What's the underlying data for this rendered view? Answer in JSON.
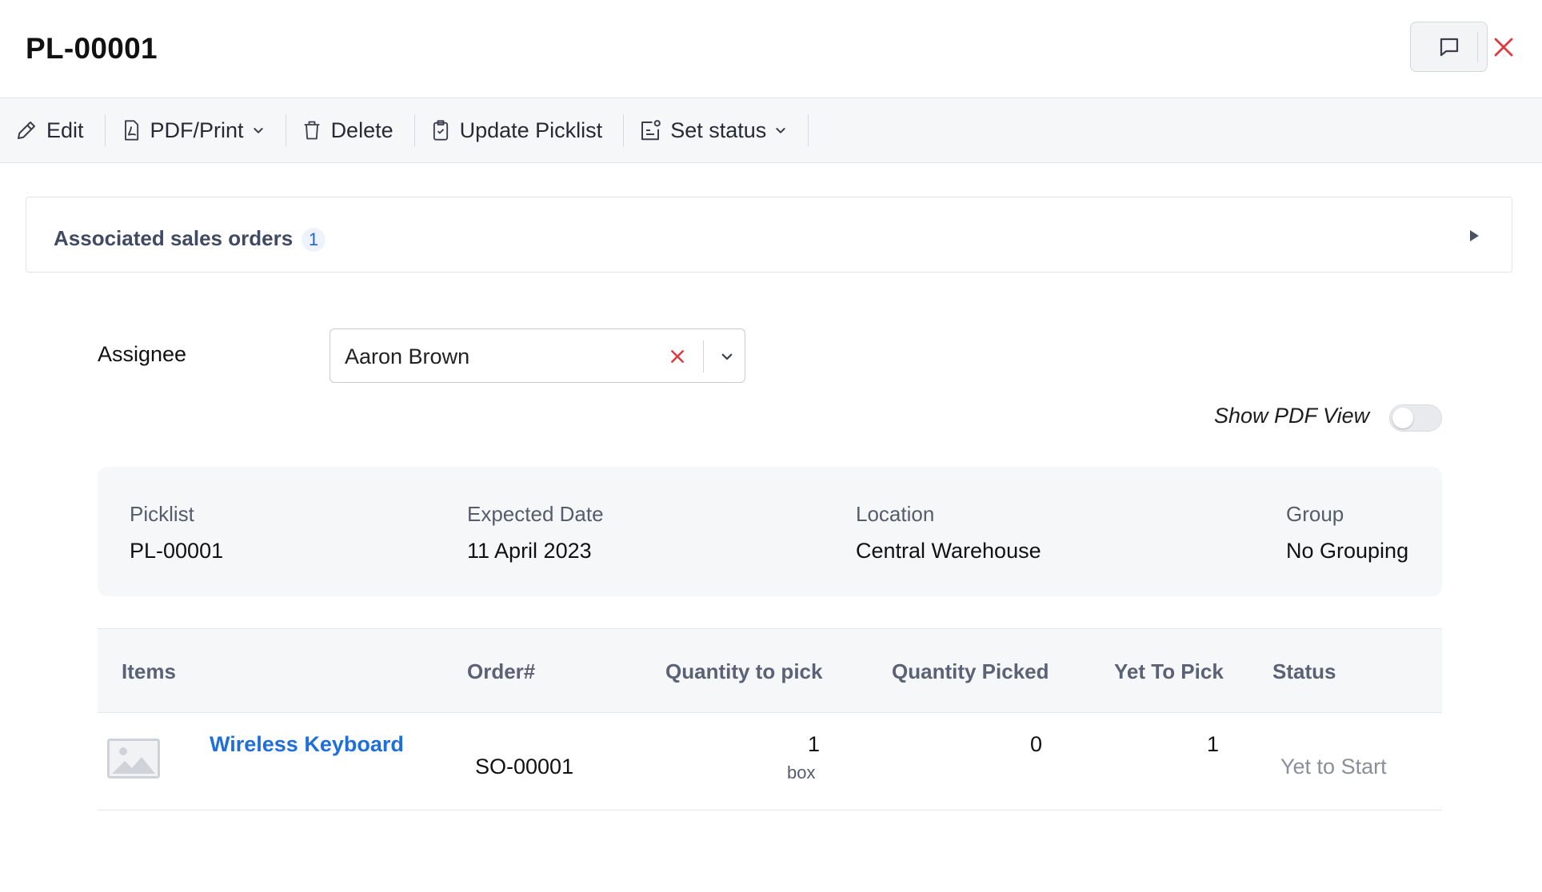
{
  "header": {
    "title": "PL-00001"
  },
  "toolbar": {
    "edit": "Edit",
    "pdf_print": "PDF/Print",
    "delete": "Delete",
    "update_picklist": "Update Picklist",
    "set_status": "Set status"
  },
  "associated": {
    "label": "Associated sales orders",
    "count": "1"
  },
  "assignee": {
    "label": "Assignee",
    "value": "Aaron Brown"
  },
  "pdf_view": {
    "label": "Show PDF View",
    "enabled": false
  },
  "summary": {
    "picklist_label": "Picklist",
    "picklist_value": "PL-00001",
    "date_label": "Expected Date",
    "date_value": "11 April 2023",
    "location_label": "Location",
    "location_value": "Central Warehouse",
    "group_label": "Group",
    "group_value": "No Grouping"
  },
  "table": {
    "columns": [
      "Items",
      "Order#",
      "Quantity to pick",
      "Quantity Picked",
      "Yet To Pick",
      "Status"
    ],
    "rows": [
      {
        "item": "Wireless Keyboard",
        "order": "SO-00001",
        "qty_to_pick": "1",
        "qty_unit": "box",
        "qty_picked": "0",
        "yet_to_pick": "1",
        "status": "Yet to Start"
      }
    ]
  },
  "colors": {
    "accent": "#1f6fdb",
    "close": "#e0383e",
    "toolbar_bg": "#f6f7f9"
  },
  "icons": {
    "comment": "comment-icon",
    "close": "close-icon",
    "edit": "pencil-icon",
    "pdf": "pdf-icon",
    "delete": "trash-icon",
    "update": "clipboard-check-icon",
    "status": "status-icon",
    "caret": "caret-right-icon",
    "image": "image-placeholder-icon"
  }
}
